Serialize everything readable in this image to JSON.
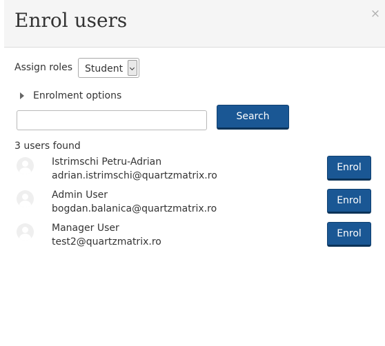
{
  "dialog": {
    "title": "Enrol users",
    "close_symbol": "×"
  },
  "assign_roles": {
    "label": "Assign roles",
    "selected": "Student"
  },
  "enrolment_options": {
    "label": "Enrolment options"
  },
  "search": {
    "value": "",
    "button_label": "Search"
  },
  "results": {
    "count_text": "3 users found",
    "users": [
      {
        "name": "Istrimschi Petru-Adrian",
        "email": "adrian.istrimschi@quartzmatrix.ro",
        "enrol_label": "Enrol"
      },
      {
        "name": "Admin User",
        "email": "bogdan.balanica@quartzmatrix.ro",
        "enrol_label": "Enrol"
      },
      {
        "name": "Manager User",
        "email": "test2@quartzmatrix.ro",
        "enrol_label": "Enrol"
      }
    ]
  },
  "icons": {
    "close": "close-icon",
    "expand": "triangle-right-icon",
    "avatar": "user-avatar-icon",
    "dropdown": "chevron-down-icon"
  },
  "colors": {
    "primary_button": "#1a5794",
    "header_bg": "#f5f5f5"
  }
}
